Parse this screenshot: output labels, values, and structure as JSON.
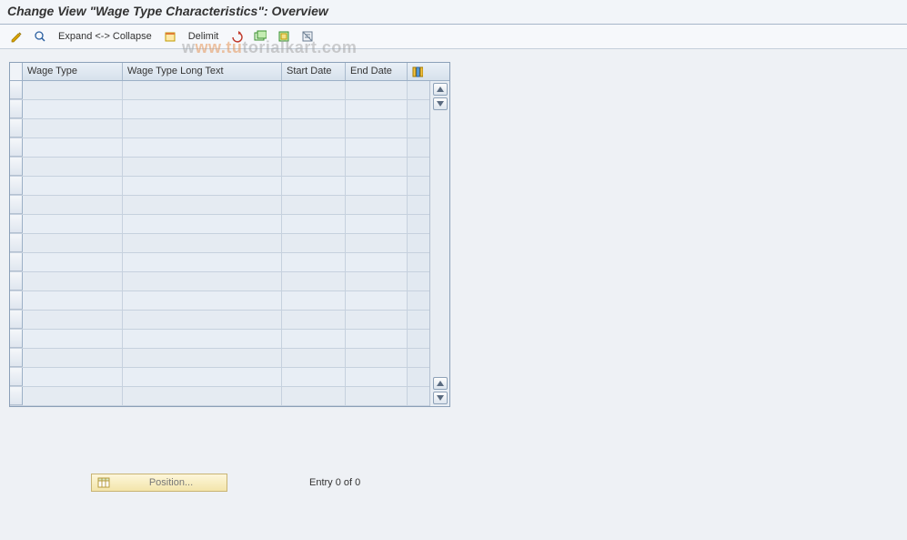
{
  "title": "Change View \"Wage Type Characteristics\": Overview",
  "toolbar": {
    "expand_label": "Expand <-> Collapse",
    "delimit_label": "Delimit"
  },
  "grid": {
    "columns": {
      "wage_type": "Wage Type",
      "wage_type_long": "Wage Type Long Text",
      "start_date": "Start Date",
      "end_date": "End Date"
    },
    "rows_visible": 17
  },
  "footer": {
    "position_label": "Position...",
    "entry_status": "Entry 0 of 0"
  },
  "watermark": {
    "pre": "w",
    "accent": "ww.t",
    "accent2": "u",
    "post": "torialkart.com"
  }
}
